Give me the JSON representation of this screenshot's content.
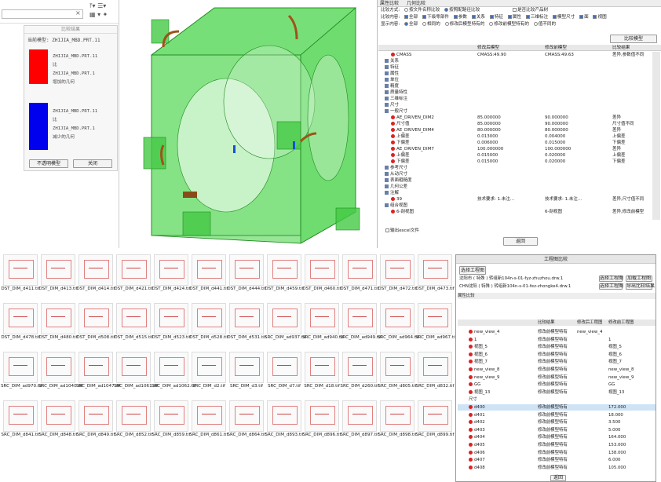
{
  "left_panel": {
    "result_title": "比较结果",
    "current_model_label": "当前模型:",
    "current_model": "ZHIJIA_MBD.PRT.11",
    "legend": [
      {
        "color": "#ff0000",
        "line1": "ZHIJIA_MBD.PRT.11",
        "line2": "比",
        "line3": "ZHIJIA_MBD.PRT.1",
        "line4": "增加的几何"
      },
      {
        "color": "#0000ee",
        "line1": "ZHIJIA_MBD.PRT.11",
        "line2": "比",
        "line3": "ZHIJIA_MBD.PRT.1",
        "line4": "减少的几何"
      }
    ],
    "btn_opaque": "不透明模型",
    "btn_close": "关闭"
  },
  "compare": {
    "tabs": [
      "属性比较",
      "几何比较"
    ],
    "method_label": "比较方式:",
    "method_opt1": "按文件名称比较",
    "method_opt2": "按照配路径比较",
    "method_opt3": "是否比较产品树",
    "content_label": "比较内容:",
    "content_opts": [
      "全部",
      "下级零部件",
      "参数",
      "关系",
      "特征",
      "属性",
      "三维标注",
      "模型尺寸",
      "面",
      "视图"
    ],
    "show_label": "显示内容:",
    "show_opts": [
      "全部",
      "相同的",
      "修改后模型特有的",
      "修改前模型特有的",
      "值不同的"
    ],
    "compare_btn": "比较模型",
    "columns": [
      "",
      "修改后模型",
      "修改前模型",
      "比较结果"
    ],
    "rows": [
      {
        "name": "CMASS",
        "after": "CMASS:49.90",
        "before": "CMASS:49.63",
        "result": "差异,参数值不同",
        "icon": "dot"
      },
      {
        "name": "关系",
        "after": "",
        "before": "",
        "result": "",
        "icon": "sq"
      },
      {
        "name": "特征",
        "after": "",
        "before": "",
        "result": "",
        "icon": "sq"
      },
      {
        "name": "属性",
        "after": "",
        "before": "",
        "result": "",
        "icon": "sq"
      },
      {
        "name": "单位",
        "after": "",
        "before": "",
        "result": "",
        "icon": "sq"
      },
      {
        "name": "精度",
        "after": "",
        "before": "",
        "result": "",
        "icon": "sq"
      },
      {
        "name": "质量特性",
        "after": "",
        "before": "",
        "result": "",
        "icon": "sq"
      },
      {
        "name": "三维标注",
        "after": "",
        "before": "",
        "result": "",
        "icon": "sq"
      },
      {
        "name": "尺寸",
        "after": "",
        "before": "",
        "result": "",
        "icon": "sq"
      },
      {
        "name": "一般尺寸",
        "after": "",
        "before": "",
        "result": "",
        "icon": "sq"
      },
      {
        "name": "AE_DRIVEN_DIM2",
        "after": "85.000000",
        "before": "90.000000",
        "result": "差异",
        "icon": "dot"
      },
      {
        "name": "尺寸值",
        "after": "85.000000",
        "before": "90.000000",
        "result": "尺寸值不同",
        "icon": "dot"
      },
      {
        "name": "AE_DRIVEN_DIM4",
        "after": "80.000000",
        "before": "80.000000",
        "result": "差异",
        "icon": "dot"
      },
      {
        "name": "上偏差",
        "after": "0.013000",
        "before": "0.004000",
        "result": "上偏差",
        "icon": "dot"
      },
      {
        "name": "下偏差",
        "after": "0.006000",
        "before": "0.015000",
        "result": "下偏差",
        "icon": "dot"
      },
      {
        "name": "AE_DRIVEN_DIM7",
        "after": "100.000000",
        "before": "100.000000",
        "result": "差异",
        "icon": "dot"
      },
      {
        "name": "上偏差",
        "after": "0.015000",
        "before": "0.020000",
        "result": "上偏差",
        "icon": "dot"
      },
      {
        "name": "下偏差",
        "after": "0.015000",
        "before": "0.020000",
        "result": "下偏差",
        "icon": "dot"
      },
      {
        "name": "参考尺寸",
        "after": "",
        "before": "",
        "result": "",
        "icon": "sq"
      },
      {
        "name": "从动尺寸",
        "after": "",
        "before": "",
        "result": "",
        "icon": "sq"
      },
      {
        "name": "表面粗糙度",
        "after": "",
        "before": "",
        "result": "",
        "icon": "sq"
      },
      {
        "name": "几何公差",
        "after": "",
        "before": "",
        "result": "",
        "icon": "sq"
      },
      {
        "name": "注解",
        "after": "",
        "before": "",
        "result": "",
        "icon": "sq"
      },
      {
        "name": "39",
        "after": "技术要求: 1.未注...",
        "before": "技术要求: 1.未注...",
        "result": "差异,尺寸值不同",
        "icon": "dot"
      },
      {
        "name": "组合视图",
        "after": "",
        "before": "",
        "result": "",
        "icon": "sq"
      },
      {
        "name": "6-剖视图",
        "after": "",
        "before": "6-剖视图",
        "result": "差异,修改前模型",
        "icon": "dot"
      }
    ],
    "export_label": "输出excel文件",
    "back_btn": "返回"
  },
  "thumbs": [
    [
      "DST_DIM_d411.tif",
      "DST_DIM_d413.tif",
      "DST_DIM_d414.tif",
      "DST_DIM_d421.tif",
      "DST_DIM_d424.tif",
      "DST_DIM_d441.tif",
      "DST_DIM_d444.tif",
      "DST_DIM_d459.tif",
      "DST_DIM_d460.tif",
      "DST_DIM_d471.tif",
      "DST_DIM_d472.tif",
      "DST_DIM_d473.tif"
    ],
    [
      "DST_DIM_d478.tif",
      "DST_DIM_d480.tif",
      "DST_DIM_d508.tif",
      "DST_DIM_d515.tif",
      "DST_DIM_d523.tif",
      "DST_DIM_d528.tif",
      "DST_DIM_d531.tif",
      "SRC_DIM_ad937.tif",
      "SRC_DIM_ad940.tif",
      "SRC_DIM_ad949.tif",
      "SRC_DIM_ad964.tif",
      "SRC_DIM_ad967.tif"
    ],
    [
      "SRC_DIM_ad970.tif",
      "SRC_DIM_ad1040.tif",
      "SRC_DIM_ad1047.tif",
      "SRC_DIM_ad1061.tif",
      "SRC_DIM_ad1062.tif",
      "SRC_DIM_d2.tif",
      "SRC_DIM_d3.tif",
      "SRC_DIM_d7.tif",
      "SRC_DIM_d18.tif",
      "SRC_DIM_d260.tif",
      "SRC_DIM_d805.tif",
      "SRC_DIM_d832.tif"
    ],
    [
      "SRC_DIM_d841.tif",
      "SRC_DIM_d848.tif",
      "SRC_DIM_d849.tif",
      "SRC_DIM_d852.tif",
      "SRC_DIM_d859.tif",
      "SRC_DIM_d861.tif",
      "SRC_DIM_d864.tif",
      "SRC_DIM_d893.tif",
      "SRC_DIM_d896.tif",
      "SRC_DIM_d897.tif",
      "SRC_DIM_d898.tif",
      "SRC_DIM_d899.tif"
    ]
  ],
  "workbench": {
    "title": "工程图比较",
    "row1_label": "选择工程图",
    "file1": "沈阳市 ( 特殊 ) 转组新104n-s-01-fyz-zhuzhou.drw.1",
    "file2": "CHN沈阳 ( 特殊 ) 转组新104n-s-01-fez-zhongke4.drw.1",
    "btn_select": "选择工程图",
    "btn_load": "加载工程图",
    "btn_export": "导出比较结果",
    "section": "属性比较",
    "cols": [
      "",
      "比较结果",
      "修改后工程图",
      "修改前工程图"
    ],
    "rows": [
      {
        "name": "new_view_4",
        "res": "修改前模型特有",
        "a": "new_view_4",
        "b": ""
      },
      {
        "name": "1",
        "res": "修改前模型特有",
        "a": "",
        "b": "1"
      },
      {
        "name": "视图_5",
        "res": "修改前模型特有",
        "a": "",
        "b": "视图_5"
      },
      {
        "name": "视图_6",
        "res": "修改前模型特有",
        "a": "",
        "b": "视图_6"
      },
      {
        "name": "视图_7",
        "res": "修改前模型特有",
        "a": "",
        "b": "视图_7"
      },
      {
        "name": "new_view_8",
        "res": "修改前模型特有",
        "a": "",
        "b": "new_view_8"
      },
      {
        "name": "new_view_9",
        "res": "修改前模型特有",
        "a": "",
        "b": "new_view_9"
      },
      {
        "name": "GG",
        "res": "修改前模型特有",
        "a": "",
        "b": "GG"
      },
      {
        "name": "视图_13",
        "res": "修改前模型特有",
        "a": "",
        "b": "视图_13"
      },
      {
        "name": "尺寸",
        "res": "",
        "a": "",
        "b": ""
      },
      {
        "name": "d400",
        "res": "修改前模型特有",
        "a": "",
        "b": "172.000"
      },
      {
        "name": "d401",
        "res": "修改前模型特有",
        "a": "",
        "b": "18.000"
      },
      {
        "name": "d402",
        "res": "修改前模型特有",
        "a": "",
        "b": "3.500"
      },
      {
        "name": "d403",
        "res": "修改前模型特有",
        "a": "",
        "b": "5.000"
      },
      {
        "name": "d404",
        "res": "修改前模型特有",
        "a": "",
        "b": "164.000"
      },
      {
        "name": "d405",
        "res": "修改前模型特有",
        "a": "",
        "b": "153.000"
      },
      {
        "name": "d406",
        "res": "修改前模型特有",
        "a": "",
        "b": "138.000"
      },
      {
        "name": "d407",
        "res": "修改前模型特有",
        "a": "",
        "b": "6.000"
      },
      {
        "name": "d408",
        "res": "修改前模型特有",
        "a": "",
        "b": "105.000"
      }
    ],
    "back": "返回"
  }
}
